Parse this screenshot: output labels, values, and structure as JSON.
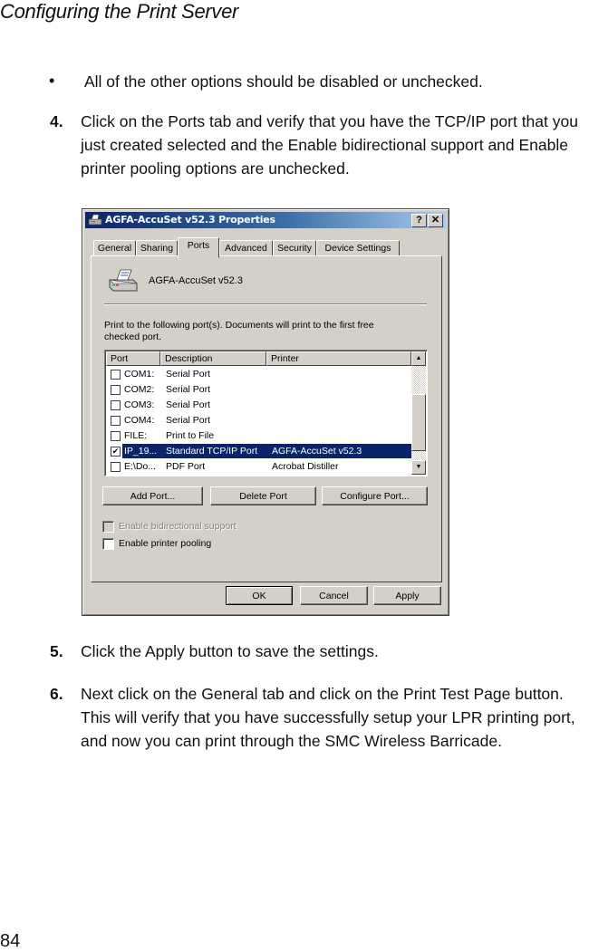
{
  "page": {
    "running_head": "Configuring the Print Server",
    "bullet": {
      "symbol": "•",
      "text": "All of the other options should be disabled or unchecked."
    },
    "steps": [
      {
        "number": "4.",
        "text": "Click on the Ports tab and verify that you have the TCP/IP port that you just created selected and the Enable bidirectional support and Enable printer pooling options are unchecked."
      },
      {
        "number": "5.",
        "text": "Click the Apply button to save the settings."
      },
      {
        "number": "6.",
        "text": "Next click on the General tab and click on the Print Test Page button. This will verify that you have successfully setup your LPR printing port, and now you can print through the SMC Wireless Barricade."
      }
    ],
    "page_number": "84"
  },
  "dialog": {
    "title": "AGFA-AccuSet v52.3 Properties",
    "title_buttons": {
      "help": "?",
      "close": "✕"
    },
    "tabs": [
      {
        "label": "General",
        "active": false
      },
      {
        "label": "Sharing",
        "active": false
      },
      {
        "label": "Ports",
        "active": true
      },
      {
        "label": "Advanced",
        "active": false
      },
      {
        "label": "Security",
        "active": false
      },
      {
        "label": "Device Settings",
        "active": false
      }
    ],
    "printer_name": "AGFA-AccuSet v52.3",
    "instructions": "Print to the following port(s). Documents will print to the first free checked port.",
    "ports_list": {
      "columns": [
        "Port",
        "Description",
        "Printer"
      ],
      "rows": [
        {
          "checked": false,
          "selected": false,
          "port": "COM1:",
          "description": "Serial Port",
          "printer": ""
        },
        {
          "checked": false,
          "selected": false,
          "port": "COM2:",
          "description": "Serial Port",
          "printer": ""
        },
        {
          "checked": false,
          "selected": false,
          "port": "COM3:",
          "description": "Serial Port",
          "printer": ""
        },
        {
          "checked": false,
          "selected": false,
          "port": "COM4:",
          "description": "Serial Port",
          "printer": ""
        },
        {
          "checked": false,
          "selected": false,
          "port": "FILE:",
          "description": "Print to File",
          "printer": ""
        },
        {
          "checked": true,
          "selected": true,
          "port": "IP_19...",
          "description": "Standard TCP/IP Port",
          "printer": "AGFA-AccuSet v52.3"
        },
        {
          "checked": false,
          "selected": false,
          "port": "E:\\Do...",
          "description": "PDF Port",
          "printer": "Acrobat Distiller"
        }
      ]
    },
    "port_buttons": {
      "add": "Add Port...",
      "delete": "Delete Port",
      "configure": "Configure Port..."
    },
    "options": {
      "bidirectional": {
        "label": "Enable bidirectional support",
        "checked": false,
        "enabled": false
      },
      "pooling": {
        "label": "Enable printer pooling",
        "checked": false,
        "enabled": true
      }
    },
    "footer_buttons": {
      "ok": "OK",
      "cancel": "Cancel",
      "apply": "Apply"
    },
    "colors": {
      "face": "#d4d0c8",
      "title_start": "#0a246a",
      "title_end": "#a6caf0",
      "selection": "#0a246a"
    }
  }
}
